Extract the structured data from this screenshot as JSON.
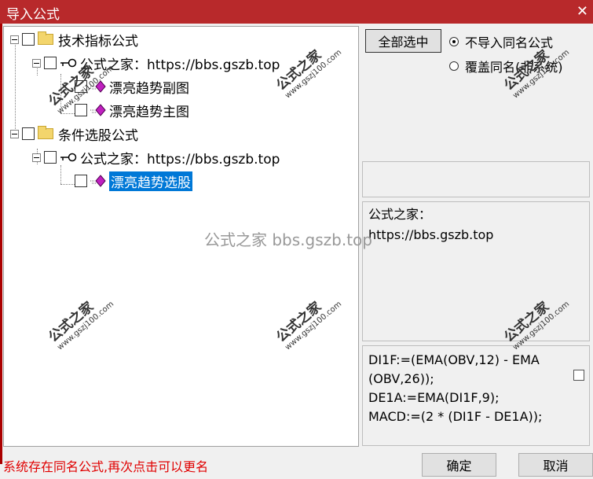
{
  "window": {
    "title": "导入公式",
    "close_glyph": "✕"
  },
  "tree": {
    "nodes": [
      {
        "label": "技术指标公式",
        "type": "folder"
      },
      {
        "label": "公式之家：https://bbs.gszb.top",
        "type": "key"
      },
      {
        "label": "漂亮趋势副图",
        "type": "formula"
      },
      {
        "label": "漂亮趋势主图",
        "type": "formula"
      },
      {
        "label": "条件选股公式",
        "type": "folder"
      },
      {
        "label": "公式之家：https://bbs.gszb.top",
        "type": "key"
      },
      {
        "label": "漂亮趋势选股",
        "type": "formula",
        "selected": true
      }
    ]
  },
  "controls": {
    "select_all_label": "全部选中",
    "radio_options": [
      {
        "label": "不导入同名公式",
        "checked": true
      },
      {
        "label": "覆盖同名(非系统)",
        "checked": false
      }
    ]
  },
  "info": {
    "line1": "公式之家：",
    "line2": "https://bbs.gszb.top"
  },
  "code": {
    "lines": [
      "DI1F:=(EMA(OBV,12) - EMA",
      "(OBV,26));",
      "DE1A:=EMA(DI1F,9);",
      "MACD:=(2 * (DI1F - DE1A));"
    ]
  },
  "status_message": "系统存在同名公式,再次点击可以更名",
  "buttons": {
    "ok_label": "确定",
    "cancel_label": "取消"
  },
  "watermark": {
    "center_text": "公式之家 bbs.gszb.top",
    "stamp_cn": "公式之家",
    "stamp_url": "www.gszj100.com"
  },
  "colors": {
    "titlebar": "#b8292b",
    "selection": "#0078d7",
    "status_text": "#e00000"
  }
}
